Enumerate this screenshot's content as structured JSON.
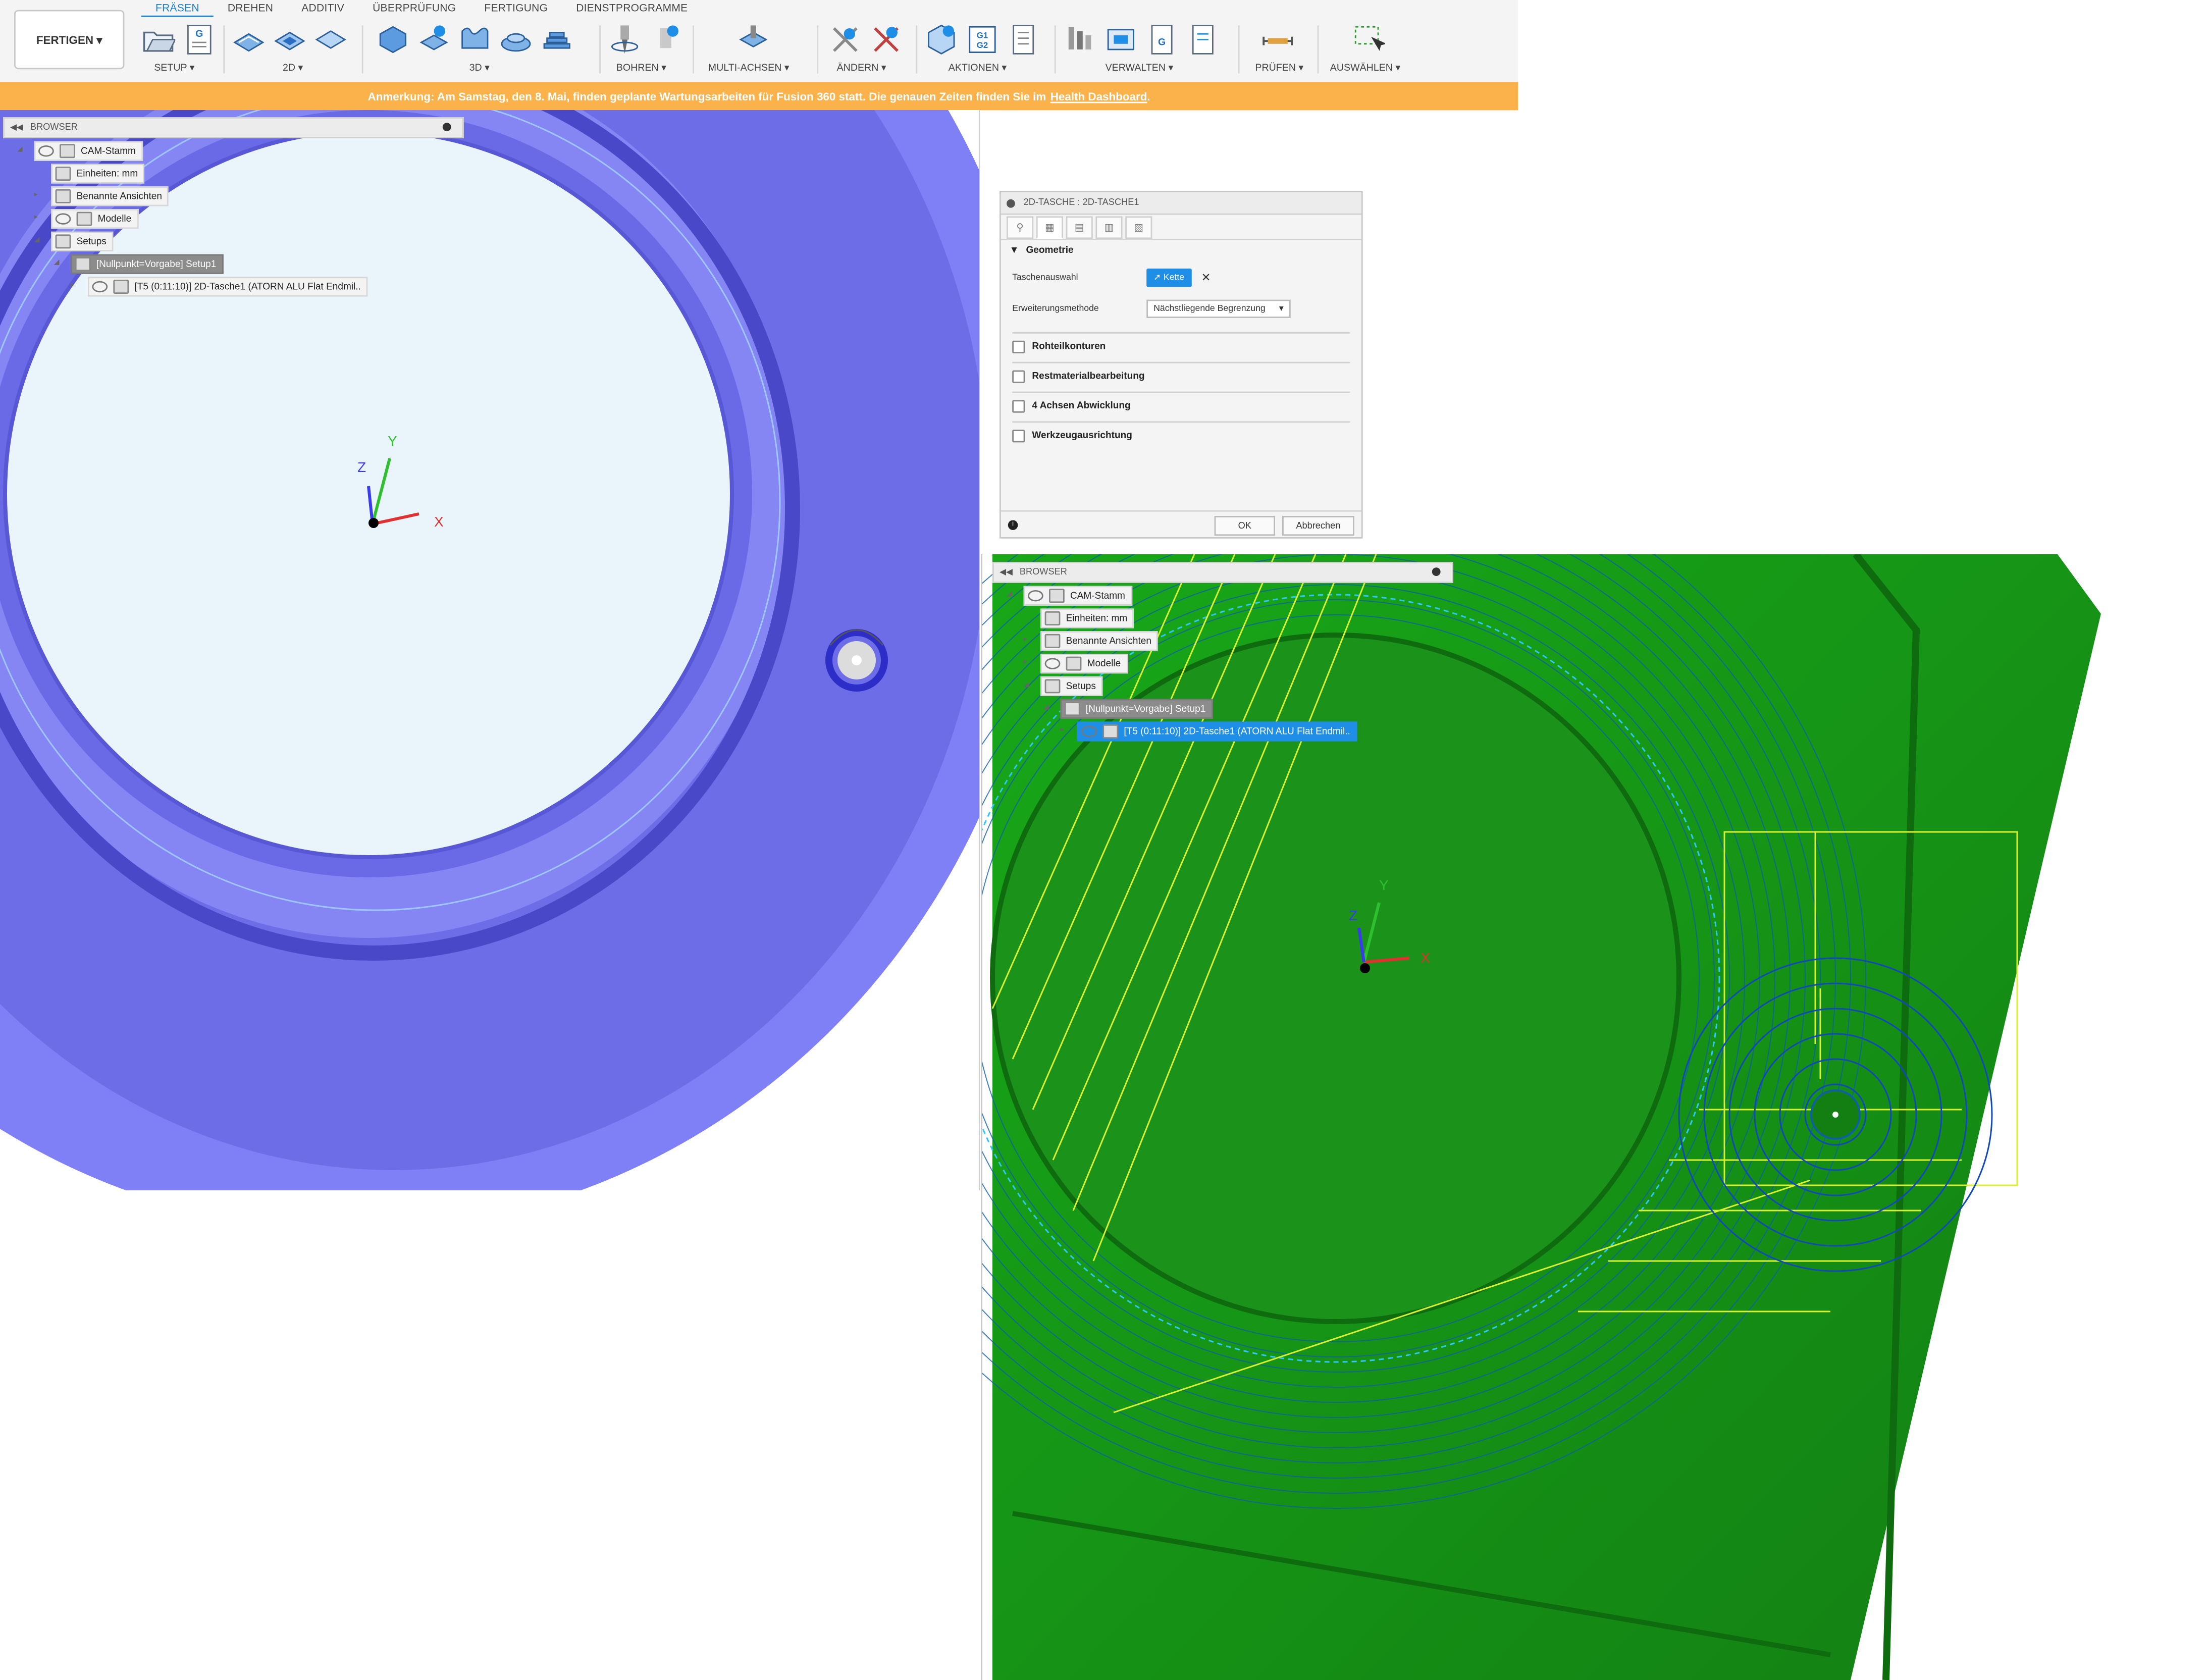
{
  "toolbar": {
    "workspace": "FERTIGEN ▾",
    "tabs": [
      {
        "label": "FRÄSEN"
      },
      {
        "label": "DREHEN"
      },
      {
        "label": "ADDITIV"
      },
      {
        "label": "ÜBERPRÜFUNG"
      },
      {
        "label": "FERTIGUNG"
      },
      {
        "label": "DIENSTPROGRAMME"
      }
    ],
    "groups": [
      {
        "label": "SETUP ▾"
      },
      {
        "label": "2D ▾"
      },
      {
        "label": "3D ▾"
      },
      {
        "label": "BOHREN ▾"
      },
      {
        "label": "MULTI-ACHSEN ▾"
      },
      {
        "label": "ÄNDERN ▾"
      },
      {
        "label": "AKTIONEN ▾"
      },
      {
        "label": "VERWALTEN ▾"
      },
      {
        "label": "PRÜFEN ▾"
      },
      {
        "label": "AUSWÄHLEN ▾"
      }
    ]
  },
  "notice": {
    "text": "Anmerkung: Am Samstag, den 8. Mai, finden geplante Wartungsarbeiten für Fusion 360 statt. Die genauen Zeiten finden Sie im",
    "link": "Health Dashboard",
    "end": "."
  },
  "browser": {
    "title": "BROWSER",
    "items": {
      "root": "CAM-Stamm",
      "units": "Einheiten: mm",
      "views": "Benannte Ansichten",
      "models": "Modelle",
      "setups": "Setups",
      "setup1": "[Nullpunkt=Vorgabe] Setup1",
      "operation": "[T5 (0:11:10)] 2D-Tasche1 (ATORN ALU Flat Endmil.."
    }
  },
  "dialog": {
    "title": "2D-TASCHE : 2D-TASCHE1",
    "section_geometry": "Geometrie",
    "pocket_selection_label": "Taschenauswahl",
    "chain_button": "Kette",
    "extension_label": "Erweiterungsmethode",
    "extension_value": "Nächstliegende Begrenzung",
    "checkboxes": [
      "Rohteilkonturen",
      "Restmaterialbearbeitung",
      "4 Achsen Abwicklung",
      "Werkzeugausrichtung"
    ],
    "ok": "OK",
    "cancel": "Abbrechen"
  },
  "viewport": {
    "axis_x": "X",
    "axis_y": "Y",
    "axis_z": "Z"
  },
  "colors": {
    "accent": "#1f8ee6",
    "notice": "#fbb24a",
    "part_left": "#7b7bf0",
    "part_right": "#1f9a1f",
    "toolpath": "#c8f028"
  }
}
